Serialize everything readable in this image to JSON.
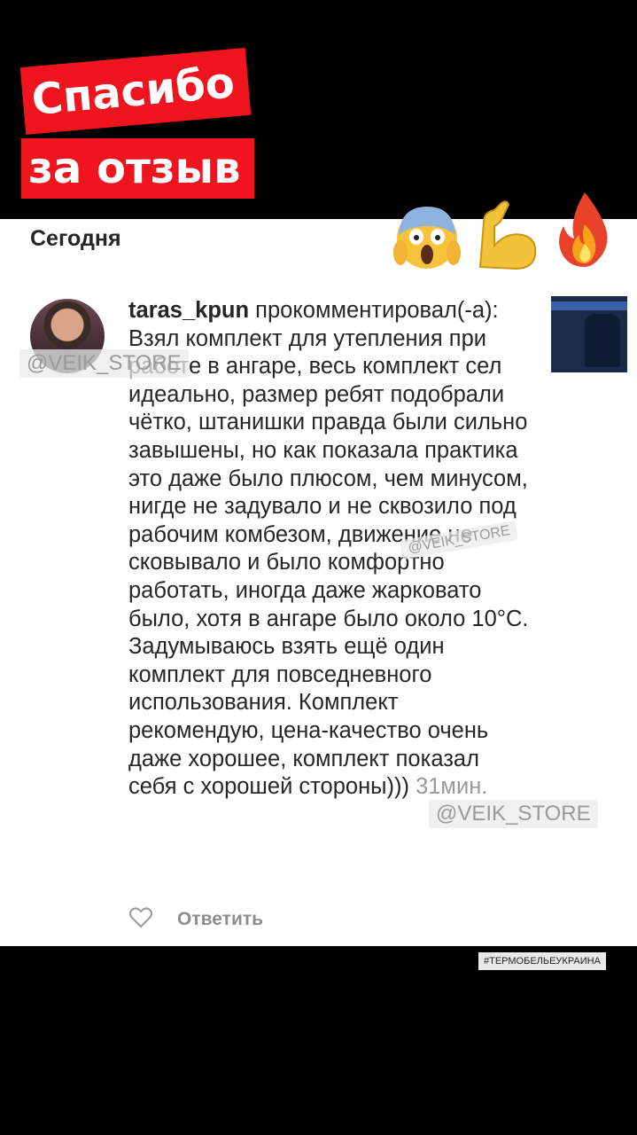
{
  "sticker": {
    "line1": "Спасибо",
    "line2": "за отзыв"
  },
  "section": {
    "title": "Сегодня"
  },
  "emojis": [
    "screaming-face-emoji",
    "flexed-biceps-emoji",
    "fire-emoji"
  ],
  "comment": {
    "username": "taras_kpun",
    "action": " прокомментировал(-а): ",
    "text": "Взял комплект для утепления при работе в ангаре, весь комплект сел идеально, размер ребят подобрали чётко, штанишки правда были сильно завышены, но как показала практика это даже было плюсом, чем минусом, нигде не задувало и не сквозило под рабочим комбезом, движение не сковывало и было комфортно работать, иногда даже жарковато было, хотя в ангаре было около 10°С. Задумываюсь взять ещё один комплект для повседневного использования. Комплект рекомендую, цена-качество очень даже хорошее, комплект показал себя с хорошей стороны)))",
    "time": " 31мин."
  },
  "actions": {
    "reply": "Ответить"
  },
  "watermarks": [
    "@VEIK_STORE",
    "@VEIK_STORE",
    "@VEIK_STORE"
  ],
  "hashtag": "#ТЕРМОБЕЛЬЕУКРАИНА",
  "colors": {
    "sticker_bg": "#f0141e",
    "background": "#000000",
    "card": "#ffffff"
  }
}
